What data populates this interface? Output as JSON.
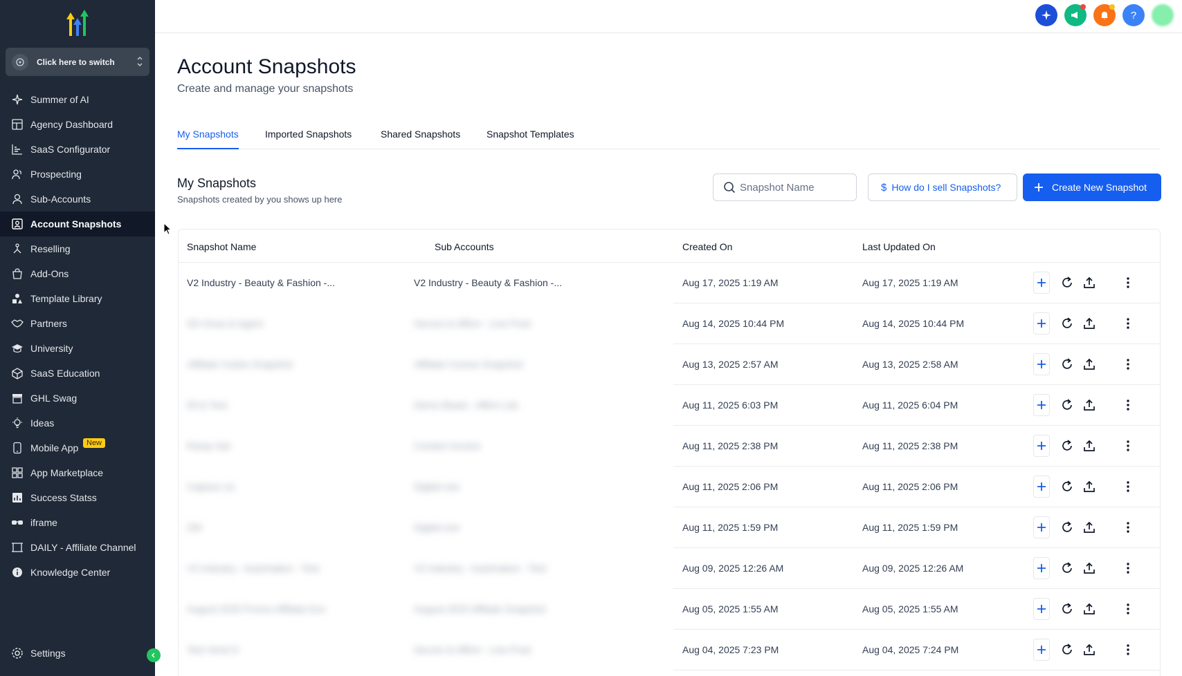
{
  "sidebar": {
    "switcher_label": "Click here to switch",
    "items": [
      {
        "label": "Summer of AI",
        "icon": "sparkle-icon"
      },
      {
        "label": "Agency Dashboard",
        "icon": "dashboard-icon"
      },
      {
        "label": "SaaS Configurator",
        "icon": "chart-icon"
      },
      {
        "label": "Prospecting",
        "icon": "users-icon"
      },
      {
        "label": "Sub-Accounts",
        "icon": "user-icon"
      },
      {
        "label": "Account Snapshots",
        "icon": "snapshot-icon",
        "active": true
      },
      {
        "label": "Reselling",
        "icon": "reselling-icon"
      },
      {
        "label": "Add-Ons",
        "icon": "bag-icon"
      },
      {
        "label": "Template Library",
        "icon": "shapes-icon"
      },
      {
        "label": "Partners",
        "icon": "handshake-icon"
      },
      {
        "label": "University",
        "icon": "cap-icon"
      },
      {
        "label": "SaaS Education",
        "icon": "cube-icon"
      },
      {
        "label": "GHL Swag",
        "icon": "store-icon"
      },
      {
        "label": "Ideas",
        "icon": "bulb-icon"
      },
      {
        "label": "Mobile App",
        "icon": "phone-icon",
        "badge": "New"
      },
      {
        "label": "App Marketplace",
        "icon": "grid-icon"
      },
      {
        "label": "Success Statss",
        "icon": "stats-icon"
      },
      {
        "label": "iframe",
        "icon": "glasses-icon"
      },
      {
        "label": "DAILY - Affiliate Channel",
        "icon": "frame-icon"
      },
      {
        "label": "Knowledge Center",
        "icon": "info-icon"
      }
    ],
    "settings_label": "Settings"
  },
  "header": {
    "title": "Account Snapshots",
    "subtitle": "Create and manage your snapshots"
  },
  "tabs": [
    {
      "label": "My Snapshots",
      "active": true
    },
    {
      "label": "Imported Snapshots"
    },
    {
      "label": "Shared Snapshots"
    },
    {
      "label": "Snapshot Templates"
    }
  ],
  "section": {
    "title": "My Snapshots",
    "subtitle": "Snapshots created by you shows up here",
    "search_placeholder": "Snapshot Name",
    "help_label": "How do I sell Snapshots?",
    "create_label": "Create New Snapshot"
  },
  "table": {
    "columns": [
      "Snapshot Name",
      "Sub Accounts",
      "Created On",
      "Last Updated On"
    ],
    "rows": [
      {
        "name": "V2 Industry - Beauty & Fashion -...",
        "sub": "V2 Industry - Beauty & Fashion -...",
        "created": "Aug 17, 2025 1:19 AM",
        "updated": "Aug 17, 2025 1:19 AM",
        "blurred": false
      },
      {
        "name": "SD Grow & Agent",
        "sub": "Secure & Affirm - Live Prod",
        "created": "Aug 14, 2025 10:44 PM",
        "updated": "Aug 14, 2025 10:44 PM",
        "blurred": true
      },
      {
        "name": "Affiliate Cashe Snapshot",
        "sub": "Affiliate Course Snapshot",
        "created": "Aug 13, 2025 2:57 AM",
        "updated": "Aug 13, 2025 2:58 AM",
        "blurred": true
      },
      {
        "name": "Ell & Test",
        "sub": "Demo Beast - Affirm Lite",
        "created": "Aug 11, 2025 6:03 PM",
        "updated": "Aug 11, 2025 6:04 PM",
        "blurred": true
      },
      {
        "name": "Ramp Sat",
        "sub": "Contact Invoice",
        "created": "Aug 11, 2025 2:38 PM",
        "updated": "Aug 11, 2025 2:38 PM",
        "blurred": true
      },
      {
        "name": "Capture on",
        "sub": "Digital one",
        "created": "Aug 11, 2025 2:06 PM",
        "updated": "Aug 11, 2025 2:06 PM",
        "blurred": true
      },
      {
        "name": "ZW",
        "sub": "Digital one",
        "created": "Aug 11, 2025 1:59 PM",
        "updated": "Aug 11, 2025 1:59 PM",
        "blurred": true
      },
      {
        "name": "V2 Industry - Automation - Test",
        "sub": "V2 Industry - Automation - Test",
        "created": "Aug 09, 2025 12:26 AM",
        "updated": "Aug 09, 2025 12:26 AM",
        "blurred": true
      },
      {
        "name": "August 2025 Promo Affiliate Env",
        "sub": "August 2025 Affiliate Snapshot",
        "created": "Aug 05, 2025 1:55 AM",
        "updated": "Aug 05, 2025 1:55 AM",
        "blurred": true
      },
      {
        "name": "Test Vend S",
        "sub": "Secure & Affirm - Live Prod",
        "created": "Aug 04, 2025 7:23 PM",
        "updated": "Aug 04, 2025 7:24 PM",
        "blurred": true
      }
    ]
  },
  "colors": {
    "sidebar_bg": "#1f2937",
    "accent": "#155eef",
    "badge_new": "#facc15"
  }
}
